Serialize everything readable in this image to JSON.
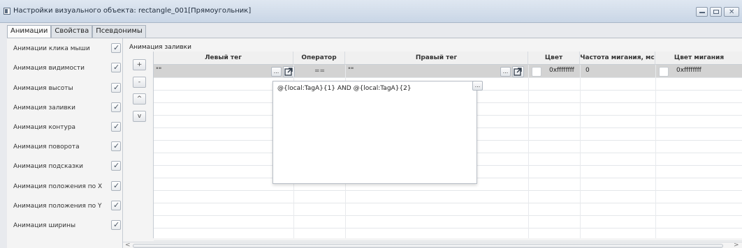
{
  "window": {
    "title": "Настройки визуального объекта: rectangle_001[Прямоугольник]"
  },
  "tabs": [
    "Анимации",
    "Свойства",
    "Псевдонимы"
  ],
  "animations": [
    "Анимации клика мыши",
    "Анимация видимости",
    "Анимация высоты",
    "Анимация заливки",
    "Анимация контура",
    "Анимация поворота",
    "Анимация подсказки",
    "Анимация положения по X",
    "Анимация положения по Y",
    "Анимация ширины"
  ],
  "section_title": "Анимация заливки",
  "side_buttons": [
    "+",
    "-",
    "^",
    "v"
  ],
  "table": {
    "columns": [
      "Левый тег",
      "Оператор",
      "Правый тег",
      "Цвет",
      "Частота мигания, мс",
      "Цвет мигания"
    ],
    "row": {
      "left_tag": "\"\"",
      "operator": "==",
      "right_tag": "\"\"",
      "color": "0xffffffff",
      "blink_rate": "0",
      "blink_color": "0xffffffff"
    },
    "ellipsis": "..."
  },
  "popup": {
    "text": "@{local:TagA}{1} AND @{local:TagA}{2}"
  },
  "scrollbar": {
    "left": "<",
    "right": ">"
  }
}
